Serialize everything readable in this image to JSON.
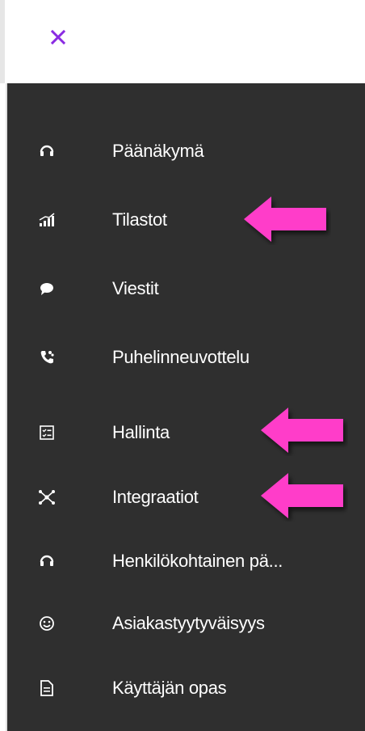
{
  "header": {
    "close_icon": "close-icon",
    "accent_color": "#8a2be2"
  },
  "nav": {
    "items": [
      {
        "label": "Päänäkymä",
        "icon": "headset-icon"
      },
      {
        "label": "Tilastot",
        "icon": "statistics-icon"
      },
      {
        "label": "Viestit",
        "icon": "chat-bubble-icon"
      },
      {
        "label": "Puhelinneuvottelu",
        "icon": "phone-conference-icon"
      },
      {
        "label": "Hallinta",
        "icon": "checklist-icon"
      },
      {
        "label": "Integraatiot",
        "icon": "integration-icon"
      },
      {
        "label": "Henkilökohtainen pä...",
        "icon": "headset-icon"
      },
      {
        "label": "Asiakastyytyväisyys",
        "icon": "smiley-icon"
      },
      {
        "label": "Käyttäjän opas",
        "icon": "document-icon"
      }
    ]
  },
  "annotations": {
    "arrow_color": "#ff3ec9",
    "highlighted_items": [
      "Tilastot",
      "Hallinta",
      "Integraatiot"
    ]
  }
}
